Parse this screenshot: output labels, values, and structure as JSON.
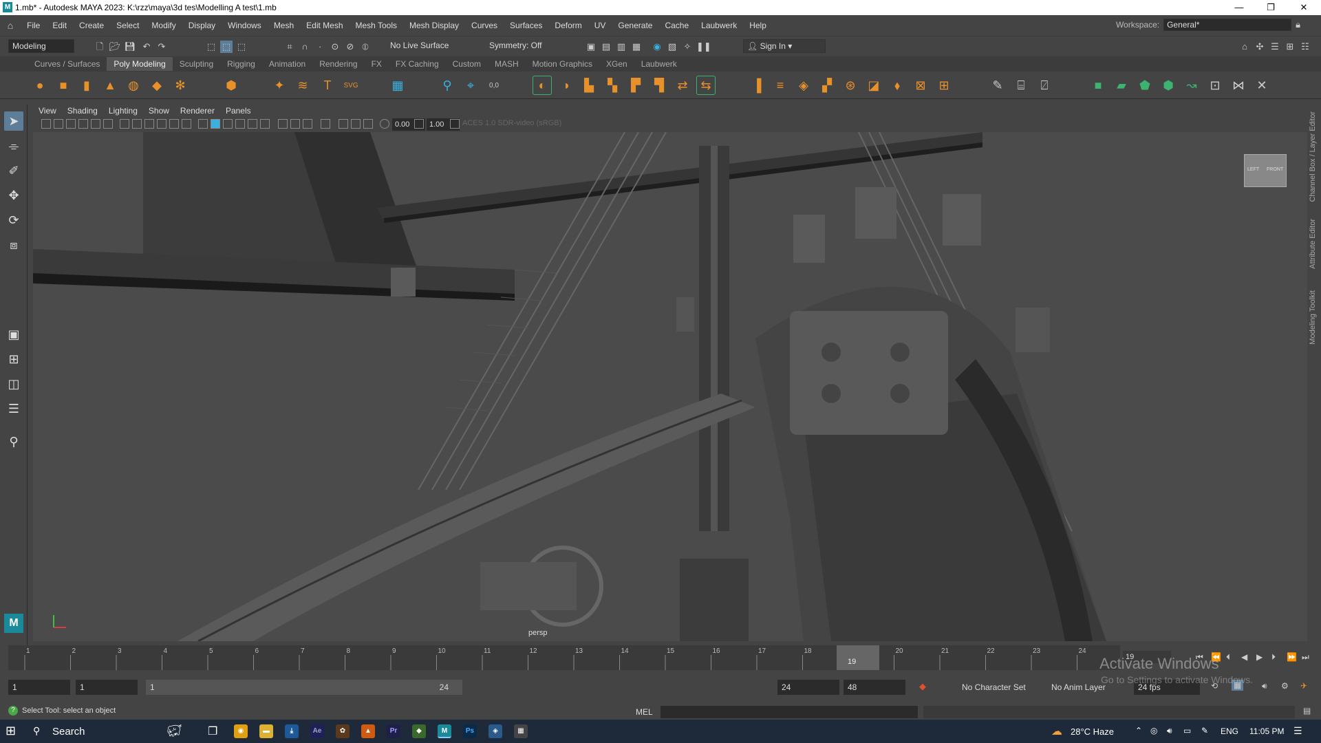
{
  "window": {
    "title": "1.mb* - Autodesk MAYA 2023: K:\\rzz\\maya\\3d tes\\Modelling A test\\1.mb",
    "minimize": "—",
    "maximize": "❐",
    "close": "✕"
  },
  "menubar": {
    "items": [
      "File",
      "Edit",
      "Create",
      "Select",
      "Modify",
      "Display",
      "Windows",
      "Mesh",
      "Edit Mesh",
      "Mesh Tools",
      "Mesh Display",
      "Curves",
      "Surfaces",
      "Deform",
      "UV",
      "Generate",
      "Cache",
      "Laubwerk",
      "Help"
    ],
    "workspace_label": "Workspace:",
    "workspace_value": "General*"
  },
  "statusline": {
    "menuset": "Modeling",
    "live_surface": "No Live Surface",
    "symmetry": "Symmetry: Off",
    "sign_in": "Sign In"
  },
  "shelf": {
    "tabs": [
      "Curves / Surfaces",
      "Poly Modeling",
      "Sculpting",
      "Rigging",
      "Animation",
      "Rendering",
      "FX",
      "FX Caching",
      "Custom",
      "MASH",
      "Motion Graphics",
      "XGen",
      "Laubwerk"
    ],
    "active_tab": "Poly Modeling"
  },
  "panel": {
    "menus": [
      "View",
      "Shading",
      "Lighting",
      "Show",
      "Renderer",
      "Panels"
    ],
    "exposure": "0.00",
    "gamma": "1.00",
    "color_space": "ACES 1.0 SDR-video (sRGB)",
    "camera_name": "persp",
    "viewcube_left": "LEFT",
    "viewcube_front": "FRONT"
  },
  "right_tabs": [
    "Channel Box / Layer Editor",
    "Attribute Editor",
    "Modeling Toolkit"
  ],
  "timeline": {
    "ticks": [
      "1",
      "2",
      "3",
      "4",
      "5",
      "6",
      "7",
      "8",
      "9",
      "10",
      "11",
      "12",
      "13",
      "14",
      "15",
      "16",
      "17",
      "18",
      "19",
      "20",
      "21",
      "22",
      "23",
      "24"
    ],
    "current_frame": "19",
    "current_frame_field": "19"
  },
  "range": {
    "start": "1",
    "playback_start": "1",
    "slider_start": "1",
    "slider_end": "24",
    "playback_end": "24",
    "end": "48",
    "character_set": "No Character Set",
    "anim_layer": "No Anim Layer",
    "fps": "24 fps"
  },
  "cmdline": {
    "label": "MEL"
  },
  "helpline": {
    "text": "Select Tool: select an object"
  },
  "watermark": {
    "line1": "Activate Windows",
    "line2": "Go to Settings to activate Windows."
  },
  "taskbar": {
    "search": "Search",
    "weather": "28°C  Haze",
    "language": "ENG",
    "time": "11:05 PM"
  },
  "colors": {
    "ui_bg": "#444444",
    "field_bg": "#2b2b2b",
    "active_blue": "#5d7d99",
    "taskbar": "#1e2a3a",
    "shelf_orange": "#e8912a",
    "shelf_green": "#3cb371"
  }
}
